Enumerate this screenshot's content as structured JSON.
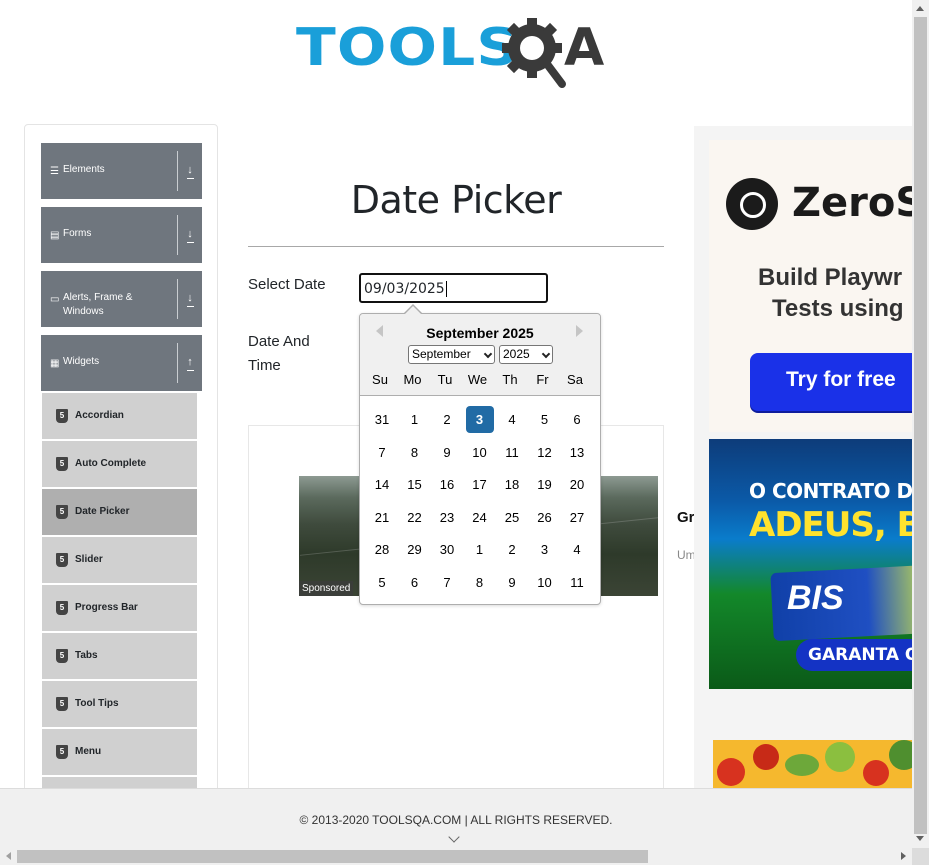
{
  "logo": {
    "tools": "TOOLS",
    "a": "A"
  },
  "sidebar": {
    "groups": [
      {
        "label": "Elements",
        "icon": "hamburger-icon",
        "expanded": false
      },
      {
        "label": "Forms",
        "icon": "form-icon",
        "expanded": false
      },
      {
        "label": "Alerts, Frame & Windows",
        "icon": "window-icon",
        "expanded": false
      },
      {
        "label": "Widgets",
        "icon": "grid-icon",
        "expanded": true
      }
    ],
    "items": [
      {
        "label": "Accordian",
        "active": false
      },
      {
        "label": "Auto Complete",
        "active": false
      },
      {
        "label": "Date Picker",
        "active": true
      },
      {
        "label": "Slider",
        "active": false
      },
      {
        "label": "Progress Bar",
        "active": false
      },
      {
        "label": "Tabs",
        "active": false
      },
      {
        "label": "Tool Tips",
        "active": false
      },
      {
        "label": "Menu",
        "active": false
      }
    ],
    "item_icon_glyph": "5"
  },
  "main": {
    "title": "Date Picker",
    "select_date_label": "Select Date",
    "date_time_label": "Date And Time",
    "date_value": "09/03/2025"
  },
  "datepicker": {
    "month_title": "September 2025",
    "month_select": "September",
    "year_select": "2025",
    "day_names": [
      "Su",
      "Mo",
      "Tu",
      "We",
      "Th",
      "Fr",
      "Sa"
    ],
    "weeks": [
      [
        "31",
        "1",
        "2",
        "3",
        "4",
        "5",
        "6"
      ],
      [
        "7",
        "8",
        "9",
        "10",
        "11",
        "12",
        "13"
      ],
      [
        "14",
        "15",
        "16",
        "17",
        "18",
        "19",
        "20"
      ],
      [
        "21",
        "22",
        "23",
        "24",
        "25",
        "26",
        "27"
      ],
      [
        "28",
        "29",
        "30",
        "1",
        "2",
        "3",
        "4"
      ],
      [
        "5",
        "6",
        "7",
        "8",
        "9",
        "10",
        "11"
      ]
    ],
    "selected_day": "3",
    "selected_color": "#216ba5"
  },
  "ads": {
    "sponsored": "Sponsored",
    "promo_text": "Gr ac",
    "promo_sub": "Um",
    "zero_name": "ZeroS",
    "zero_line1": "Build Playwr",
    "zero_line2": "Tests using",
    "zero_button": "Try for free",
    "bis_line1": "O CONTRATO DO ÍDOLO A",
    "bis_line2": "ADEUS, BIS LI",
    "bis_pack": "BIS",
    "bis_button": "GARANTA O SEU"
  },
  "footer": {
    "text": "© 2013-2020 TOOLSQA.COM | ALL RIGHTS RESERVED."
  }
}
